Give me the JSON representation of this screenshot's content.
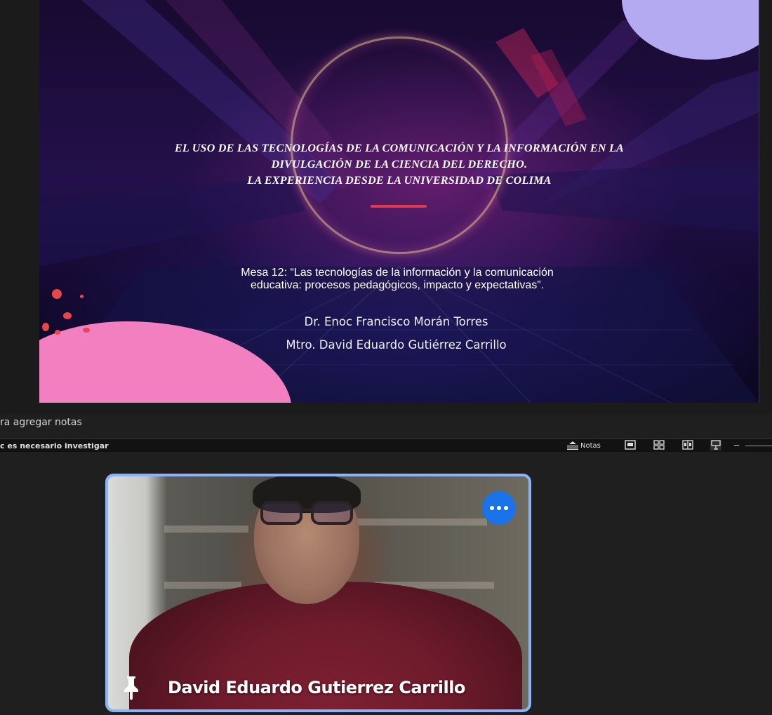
{
  "slide": {
    "title_lines": [
      "EL USO DE LAS TECNOLOGÍAS DE LA COMUNICACIÓN Y LA INFORMACIÓN EN LA",
      "DIVULGACIÓN DE LA CIENCIA DEL DERECHO.",
      "LA EXPERIENCIA DESDE LA UNIVERSIDAD DE COLIMA"
    ],
    "mesa": "Mesa 12: “Las tecnologías de la información y la comunicación educativa: procesos pedagógicos, impacto y expectativas”.",
    "authors": [
      "Dr. Enoc Francisco Morán Torres",
      "Mtro. David Eduardo Gutiérrez Carrillo"
    ],
    "colors": {
      "title_bar": "#e23a48",
      "blob_pink": "#f27fc0",
      "blob_lavender": "#b4aaf2"
    }
  },
  "notes": {
    "placeholder": "ra agregar notas"
  },
  "status_bar": {
    "slide_name": "c es necesario investigar",
    "notes_label": "Notas",
    "view_buttons": [
      "normal-view-icon",
      "slide-sorter-icon",
      "reading-view-icon",
      "presenter-view-icon"
    ],
    "zoom_minus": "–"
  },
  "video": {
    "participant_name": "David Eduardo Gutierrez Carrillo",
    "more_button_icon": "more-options-icon",
    "pin_icon": "pin-icon",
    "tile_border_color": "#8ab4f8",
    "more_button_color": "#1a73e8"
  }
}
